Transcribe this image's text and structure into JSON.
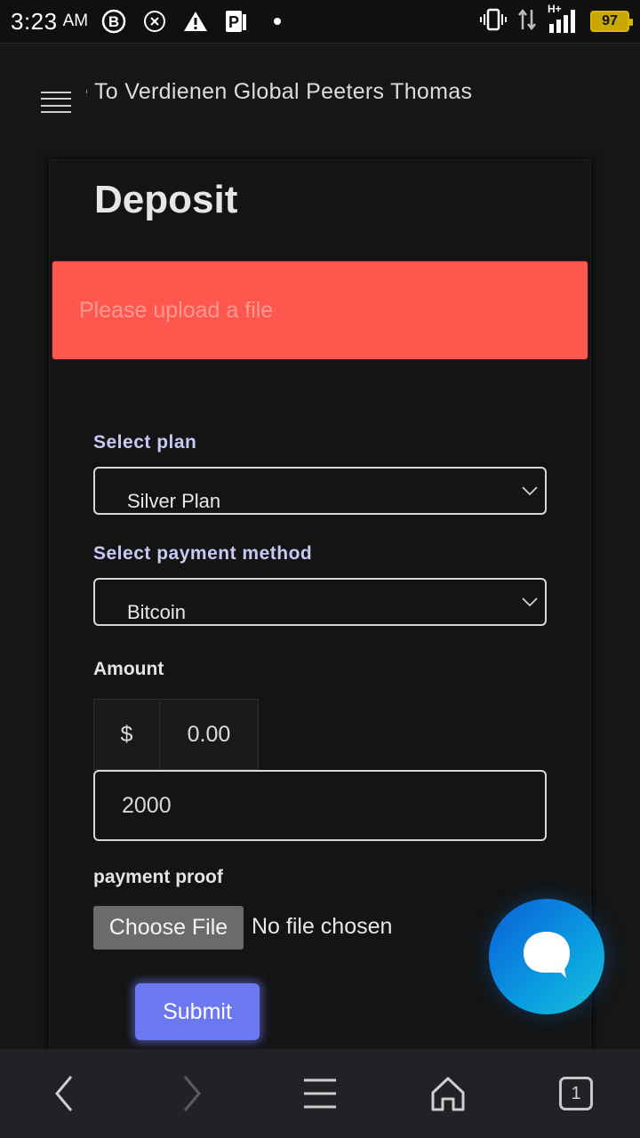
{
  "status_bar": {
    "time": "3:23",
    "ampm": "AM",
    "battery": "97",
    "network": "H+",
    "icons": [
      "b-circle-icon",
      "x-circle-icon",
      "warning-icon",
      "parking-icon",
      "dot-icon",
      "vibrate-icon",
      "data-arrows-icon",
      "signal-icon",
      "battery-icon"
    ]
  },
  "header": {
    "menu_icon": "hamburger-icon",
    "marquee": "e To Verdienen Global Peeters Thomas"
  },
  "page": {
    "title": "Deposit"
  },
  "alert": {
    "message": "Please upload a file",
    "color": "#ff574d"
  },
  "form": {
    "plan_label": "Select plan",
    "plan_value": "Silver Plan",
    "method_label": "Select payment method",
    "method_value": "Bitcoin",
    "amount_label": "Amount",
    "currency_symbol": "$",
    "amount_prefix_value": "0.00",
    "amount_value": "2000",
    "proof_label": "payment proof",
    "choose_file_label": "Choose File",
    "file_status": "No file chosen",
    "submit_label": "Submit"
  },
  "colors": {
    "accent": "#6b78f0",
    "label_purple": "#c8c8f4",
    "chat_fab": "#0a86dc"
  },
  "bottom_nav": {
    "tabs_count": "1",
    "icons": [
      "back-icon",
      "forward-icon",
      "menu-icon",
      "home-icon",
      "tabs-icon"
    ]
  }
}
